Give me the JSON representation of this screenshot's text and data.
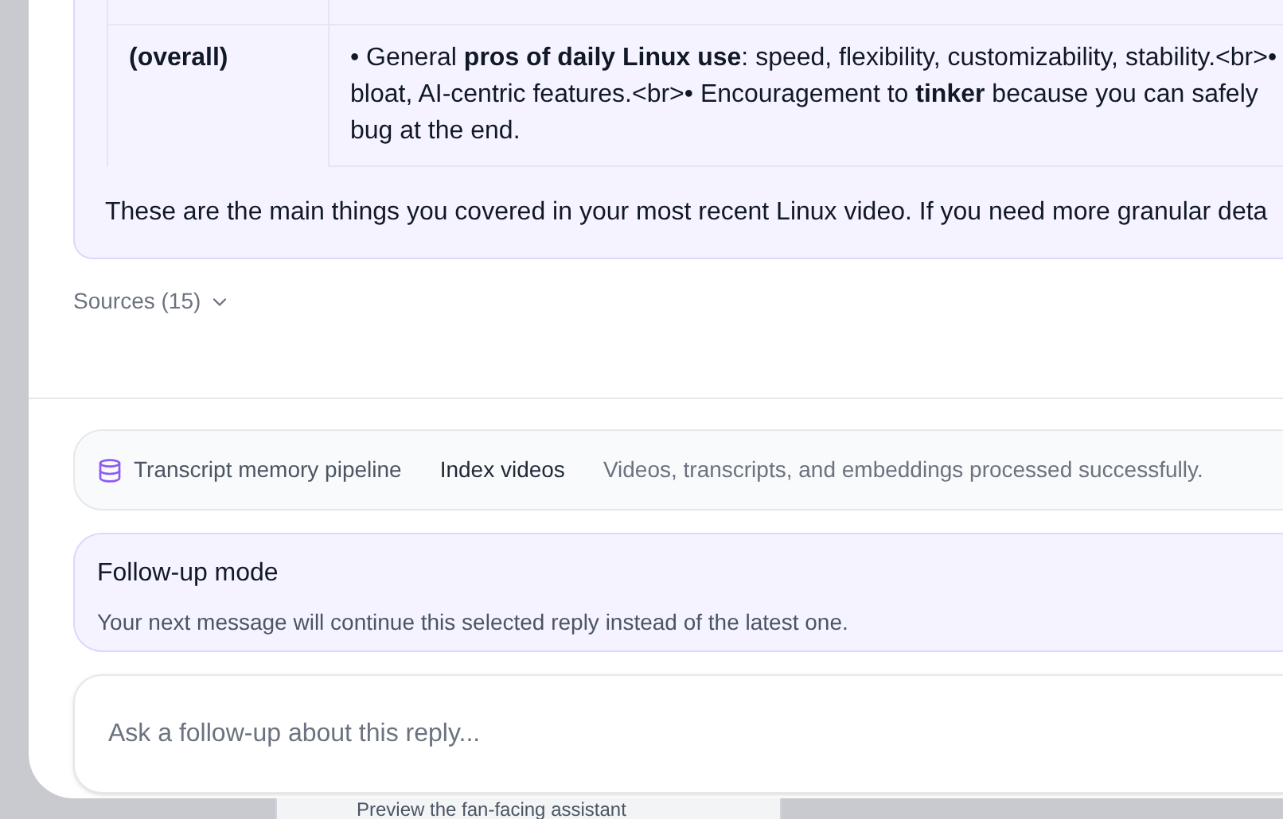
{
  "answer": {
    "table": {
      "rows": [
        {
          "label": "(overall)",
          "lines": [
            "• General **pros of daily Linux use**: speed, flexibility, customizability, stability.<br>•",
            "bloat, AI-centric features.<br>• Encouragement to **tinker** because you can safely",
            "bug at the end."
          ]
        }
      ]
    },
    "summary": "These are the main things you covered in your most recent Linux video. If you need more granular deta"
  },
  "sources": {
    "label": "Sources (15)"
  },
  "pipeline": {
    "name": "Transcript memory pipeline",
    "step": "Index videos",
    "status": "Videos, transcripts, and embeddings processed successfully."
  },
  "follow_up": {
    "title": "Follow-up mode",
    "description": "Your next message will continue this selected reply instead of the latest one."
  },
  "input": {
    "placeholder": "Ask a follow-up about this reply..."
  },
  "background_card": {
    "text": "Preview the fan-facing assistant"
  }
}
